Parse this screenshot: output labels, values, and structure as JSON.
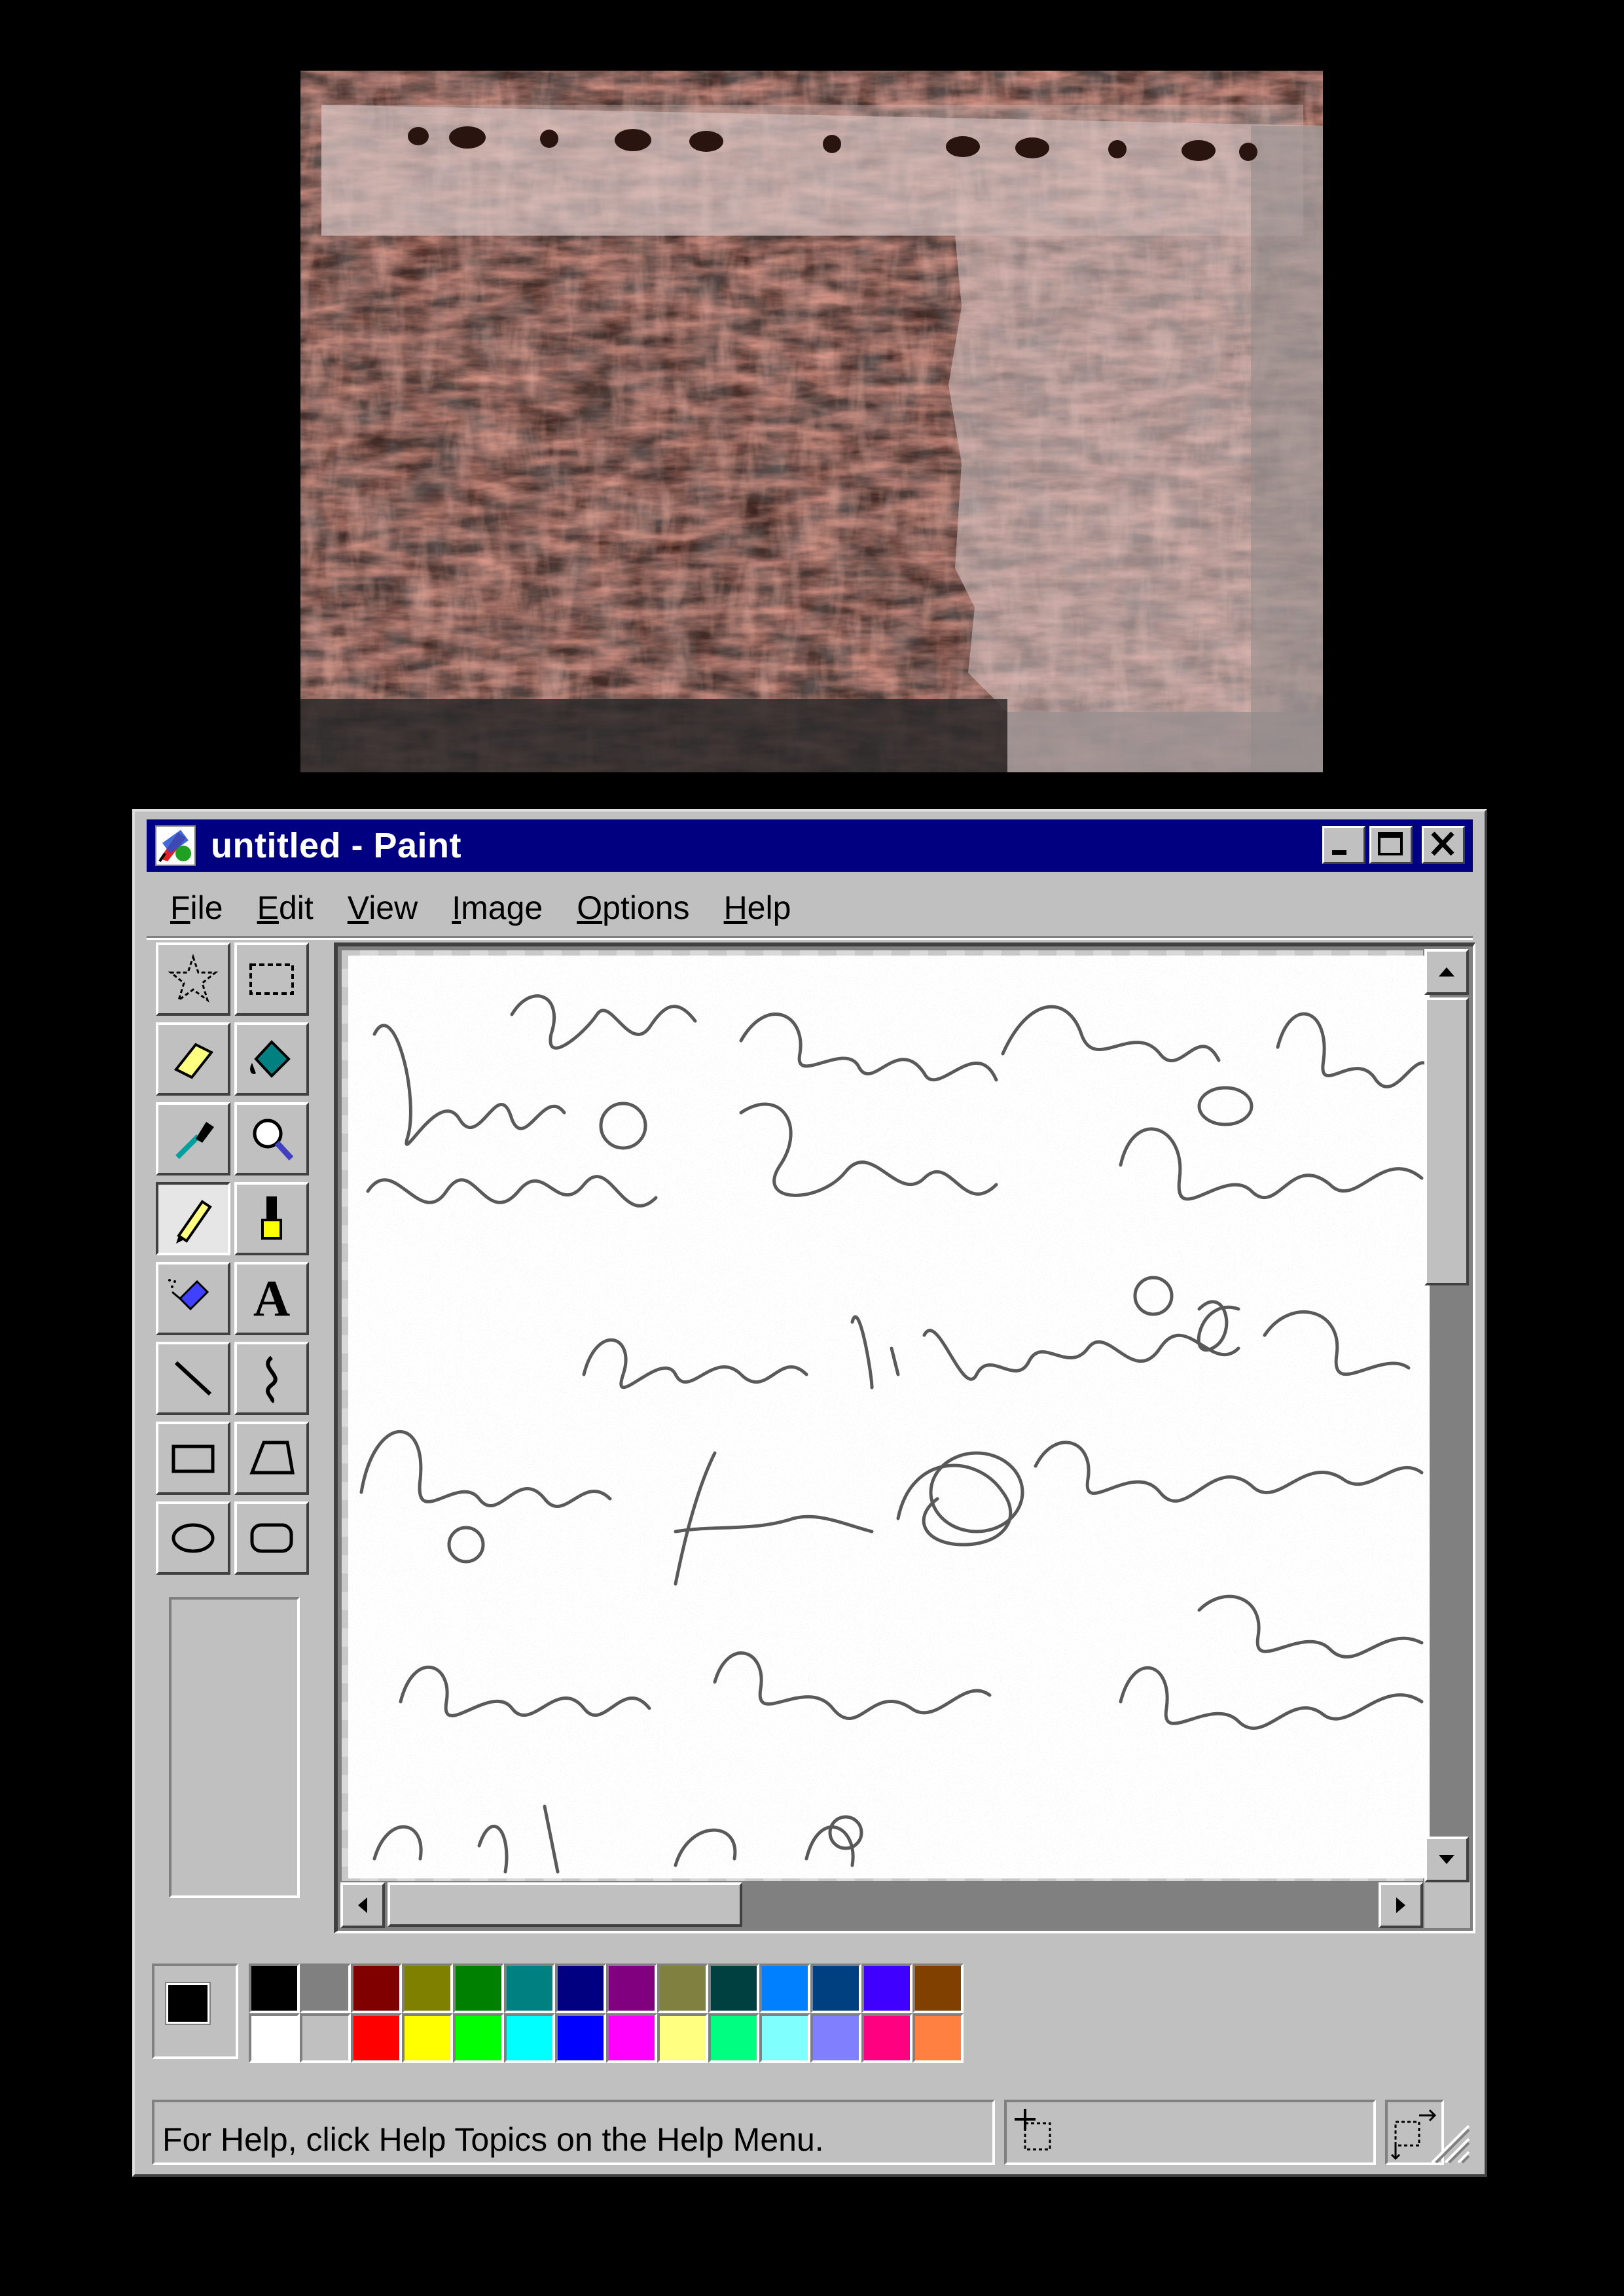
{
  "window": {
    "title": "untitled - Paint",
    "icon": "paint-app-icon"
  },
  "title_buttons": [
    "minimize-icon",
    "maximize-icon",
    "close-icon"
  ],
  "menu": [
    {
      "label": "File",
      "ul": "F",
      "rest": "ile"
    },
    {
      "label": "Edit",
      "ul": "E",
      "rest": "dit"
    },
    {
      "label": "View",
      "ul": "V",
      "rest": "iew"
    },
    {
      "label": "Image",
      "ul": "I",
      "rest": "mage"
    },
    {
      "label": "Options",
      "ul": "O",
      "rest": "ptions"
    },
    {
      "label": "Help",
      "ul": "H",
      "rest": "elp"
    }
  ],
  "tools": [
    "free-form-select-icon",
    "select-icon",
    "eraser-icon",
    "fill-bucket-icon",
    "color-picker-icon",
    "magnifier-icon",
    "pencil-icon",
    "brush-icon",
    "airbrush-icon",
    "text-icon",
    "line-icon",
    "curve-icon",
    "rectangle-icon",
    "polygon-icon",
    "ellipse-icon",
    "rounded-rectangle-icon"
  ],
  "selected_tool": "pencil-icon",
  "text_tool_glyph": "A",
  "colors": {
    "foreground": "#000000",
    "background": "#ffffff",
    "palette_top": [
      "#000000",
      "#808080",
      "#800000",
      "#808000",
      "#008000",
      "#008080",
      "#000080",
      "#800080",
      "#808040",
      "#004040",
      "#0080ff",
      "#004080",
      "#4000ff",
      "#804000"
    ],
    "palette_bottom": [
      "#ffffff",
      "#c0c0c0",
      "#ff0000",
      "#ffff00",
      "#00ff00",
      "#00ffff",
      "#0000ff",
      "#ff00ff",
      "#ffff80",
      "#00ff80",
      "#80ffff",
      "#8080ff",
      "#ff0080",
      "#ff8040"
    ],
    "title_bar": "#000080",
    "window": "#c0c0c0"
  },
  "status": {
    "help_text": "For Help, click Help Topics on the Help Menu."
  }
}
